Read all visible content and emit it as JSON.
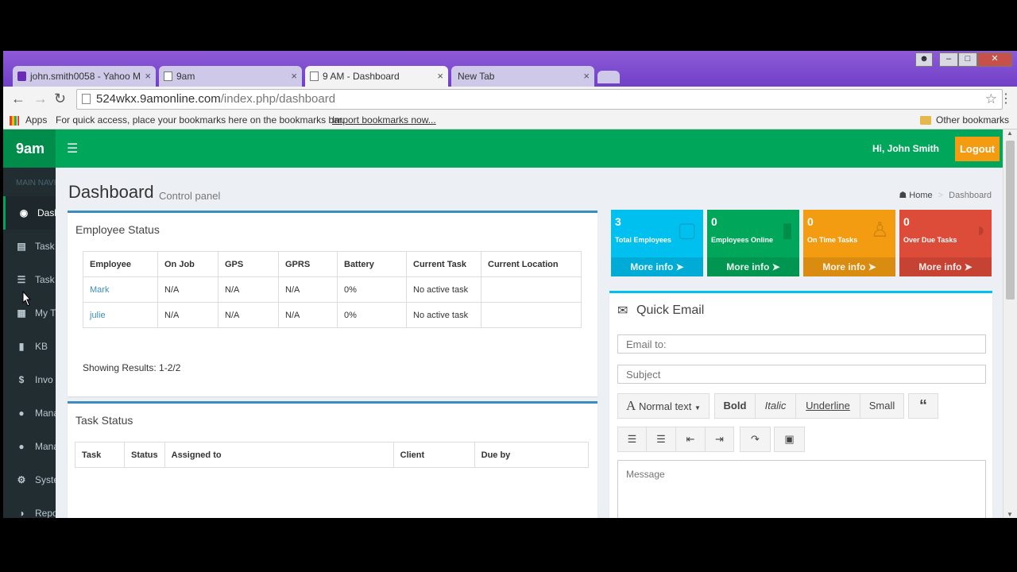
{
  "browser": {
    "tabs": [
      {
        "title": "john.smith0058 - Yahoo M"
      },
      {
        "title": "9am"
      },
      {
        "title": "9 AM - Dashboard"
      },
      {
        "title": "New Tab"
      }
    ],
    "url_host": "524wkx.9amonline.com",
    "url_path": "/index.php/dashboard",
    "bookmarks": {
      "apps": "Apps",
      "hint": "For quick access, place your bookmarks here on the bookmarks bar.",
      "import": "Import bookmarks now...",
      "other": "Other bookmarks"
    }
  },
  "app": {
    "logo": "9am",
    "greeting": "Hi, John Smith",
    "logout": "Logout"
  },
  "sidebar": {
    "header": "MAIN NAVI",
    "items": [
      {
        "label": "Dash",
        "icon": "dashboard-icon"
      },
      {
        "label": "Task",
        "icon": "list-icon"
      },
      {
        "label": "Task",
        "icon": "bars-icon"
      },
      {
        "label": "My T",
        "icon": "calendar-icon"
      },
      {
        "label": "KB",
        "icon": "book-icon"
      },
      {
        "label": "Invo",
        "icon": "dollar-icon"
      },
      {
        "label": "Mana",
        "icon": "users-icon"
      },
      {
        "label": "Mana",
        "icon": "user-icon"
      },
      {
        "label": "Syste",
        "icon": "cogs-icon"
      },
      {
        "label": "Repo",
        "icon": "pie-chart-icon"
      }
    ]
  },
  "page": {
    "title": "Dashboard",
    "subtitle": "Control panel",
    "breadcrumb": {
      "home": "Home",
      "current": "Dashboard"
    }
  },
  "employee_status": {
    "title": "Employee Status",
    "columns": [
      "Employee",
      "On Job",
      "GPS",
      "GPRS",
      "Battery",
      "Current Task",
      "Current Location"
    ],
    "rows": [
      [
        "Mark",
        "N/A",
        "N/A",
        "N/A",
        "0%",
        "No active task",
        ""
      ],
      [
        "julie",
        "N/A",
        "N/A",
        "N/A",
        "0%",
        "No active task",
        ""
      ]
    ],
    "showing": "Showing Results: 1-2/2"
  },
  "task_status": {
    "title": "Task Status",
    "columns": [
      "Task",
      "Status",
      "Assigned to",
      "Client",
      "Due by"
    ]
  },
  "stats": [
    {
      "value": "3",
      "label": "Total Employees",
      "more": "More info",
      "color": "#00c0ef",
      "icon": "shopping-bag-icon"
    },
    {
      "value": "0",
      "label": "Employees Online",
      "more": "More info",
      "color": "#00a65a",
      "icon": "bar-chart-icon"
    },
    {
      "value": "0",
      "label": "On Time Tasks",
      "more": "More info",
      "color": "#f39c12",
      "icon": "user-add-icon"
    },
    {
      "value": "0",
      "label": "Over Due Tasks",
      "more": "More info",
      "color": "#dd4b39",
      "icon": "pie-chart-icon"
    }
  ],
  "quick_email": {
    "title": "Quick Email",
    "email_placeholder": "Email to:",
    "subject_placeholder": "Subject",
    "message_placeholder": "Message",
    "toolbar": {
      "normal_text": "Normal text",
      "bold": "Bold",
      "italic": "Italic",
      "underline": "Underline",
      "small": "Small"
    }
  }
}
